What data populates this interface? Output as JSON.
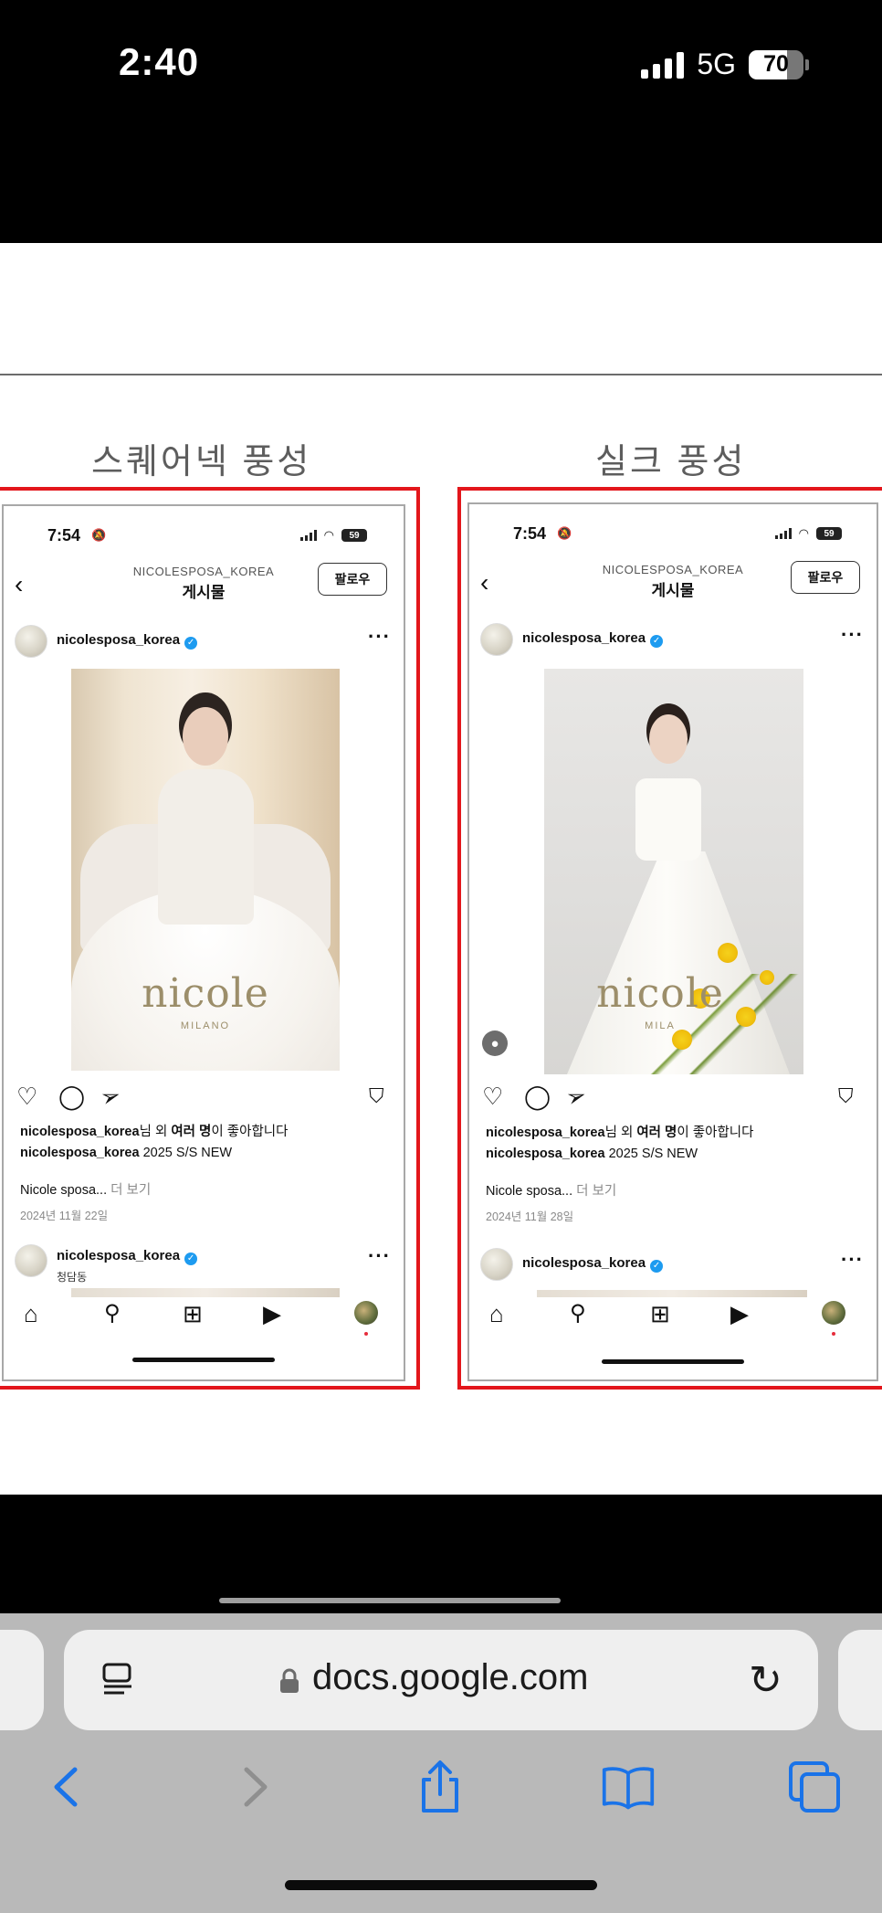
{
  "status_bar": {
    "time": "2:40",
    "network": "5G",
    "battery": "70"
  },
  "columns": [
    {
      "heading": "스퀘어넥 풍성",
      "phone": {
        "time": "7:54",
        "battery": "59",
        "account": "NICOLESPOSA_KOREA",
        "title": "게시물",
        "follow": "팔로우",
        "username": "nicolesposa_korea",
        "watermark": "nicole",
        "watermark_sub": "MILANO",
        "likes_user": "nicolesposa_korea",
        "likes_mid": "님 외 ",
        "likes_bold": "여러 명",
        "likes_tail": "이 좋아합니다",
        "caption_user": "nicolesposa_korea",
        "caption_text": " 2025 S/S NEW",
        "caption_more_text": "Nicole sposa... ",
        "more": "더 보기",
        "date": "2024년 11월 22일",
        "next_username": "nicolesposa_korea",
        "next_sub": "청담동"
      }
    },
    {
      "heading": "실크 풍성",
      "phone": {
        "time": "7:54",
        "battery": "59",
        "account": "NICOLESPOSA_KOREA",
        "title": "게시물",
        "follow": "팔로우",
        "username": "nicolesposa_korea",
        "watermark": "nicole",
        "watermark_sub": "MILA",
        "likes_user": "nicolesposa_korea",
        "likes_mid": "님 외 ",
        "likes_bold": "여러 명",
        "likes_tail": "이 좋아합니다",
        "caption_user": "nicolesposa_korea",
        "caption_text": " 2025 S/S NEW",
        "caption_more_text": "Nicole sposa... ",
        "more": "더 보기",
        "date": "2024년 11월 28일",
        "next_username": "nicolesposa_korea"
      }
    }
  ],
  "browser": {
    "url": "docs.google.com",
    "icons": [
      "reader-icon",
      "lock-icon",
      "reload-icon",
      "back-icon",
      "forward-icon",
      "share-icon",
      "bookmarks-icon",
      "tabs-icon"
    ],
    "accent": "#1a73e8"
  }
}
